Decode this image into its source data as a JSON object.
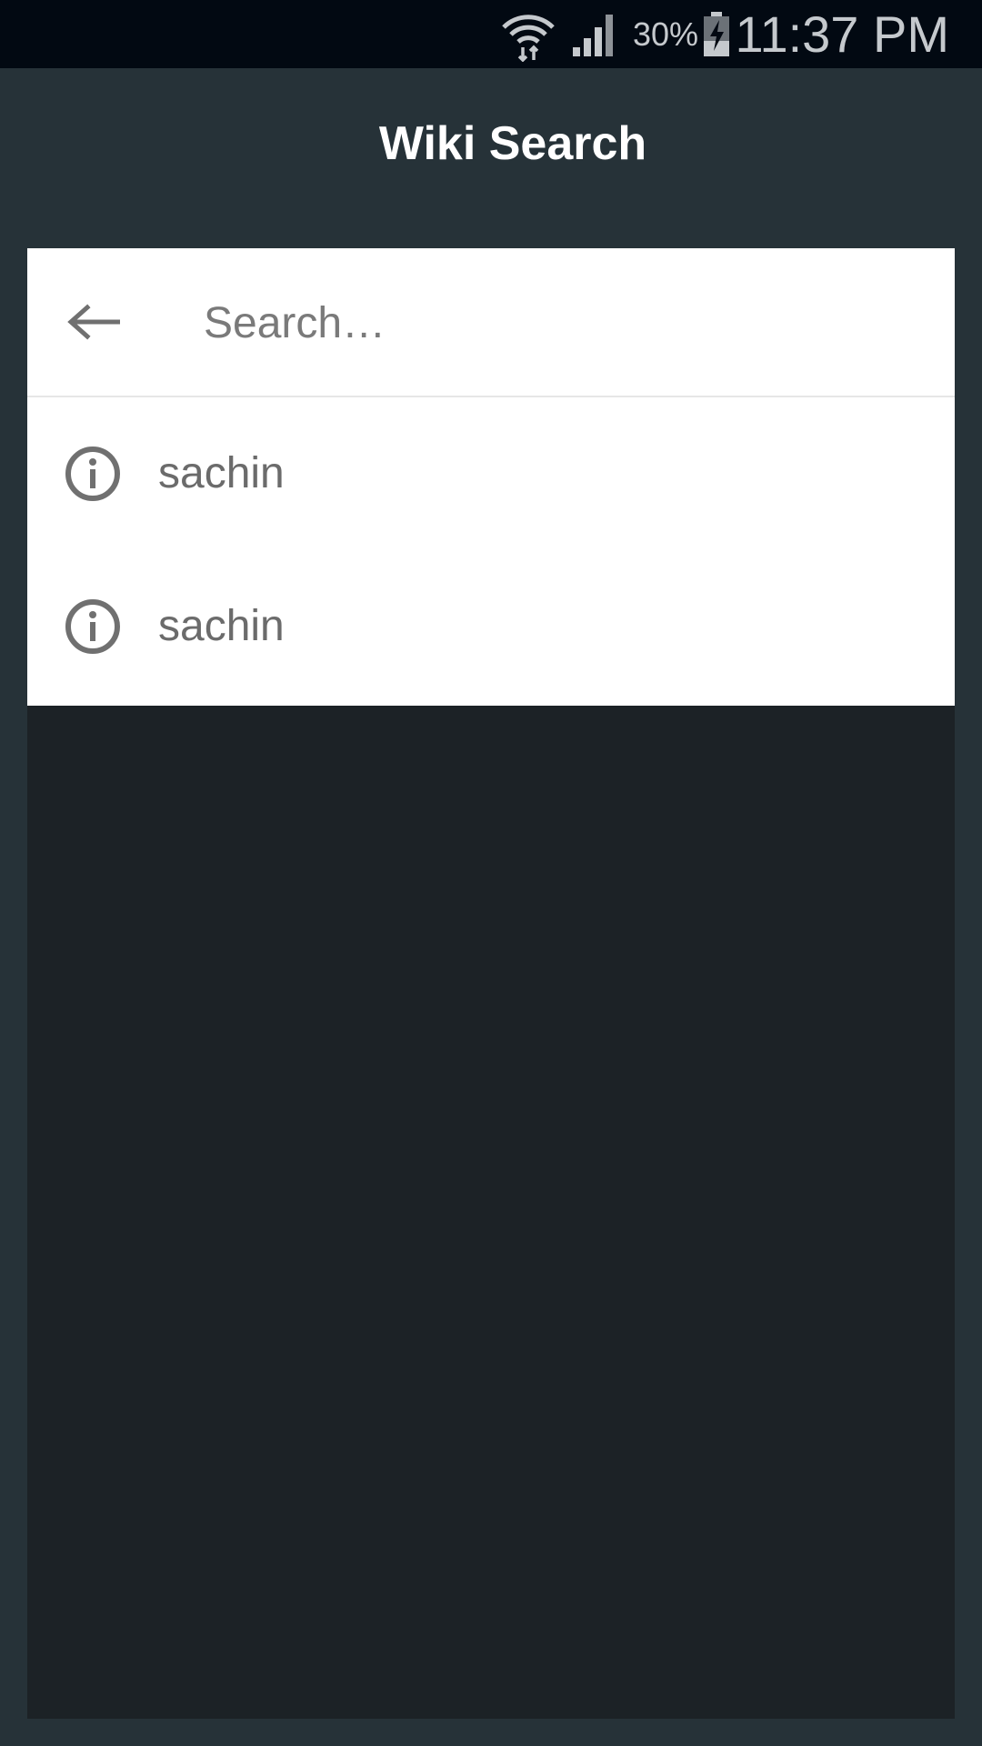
{
  "status_bar": {
    "battery_percent": "30%",
    "time": "11:37 PM",
    "icons": [
      "wifi-icon",
      "signal-icon",
      "battery-charging-icon"
    ]
  },
  "app_bar": {
    "title": "Wiki Search"
  },
  "search": {
    "placeholder": "Search…",
    "value": "",
    "back_icon": "arrow-left-icon"
  },
  "suggestions": [
    {
      "label": "sachin",
      "icon": "info-icon"
    },
    {
      "label": "sachin",
      "icon": "info-icon"
    }
  ],
  "colors": {
    "status_bar_bg": "#020912",
    "app_bg": "#263238",
    "content_bg": "#1c2226",
    "card_bg": "#ffffff",
    "icon_gray": "#707070"
  }
}
